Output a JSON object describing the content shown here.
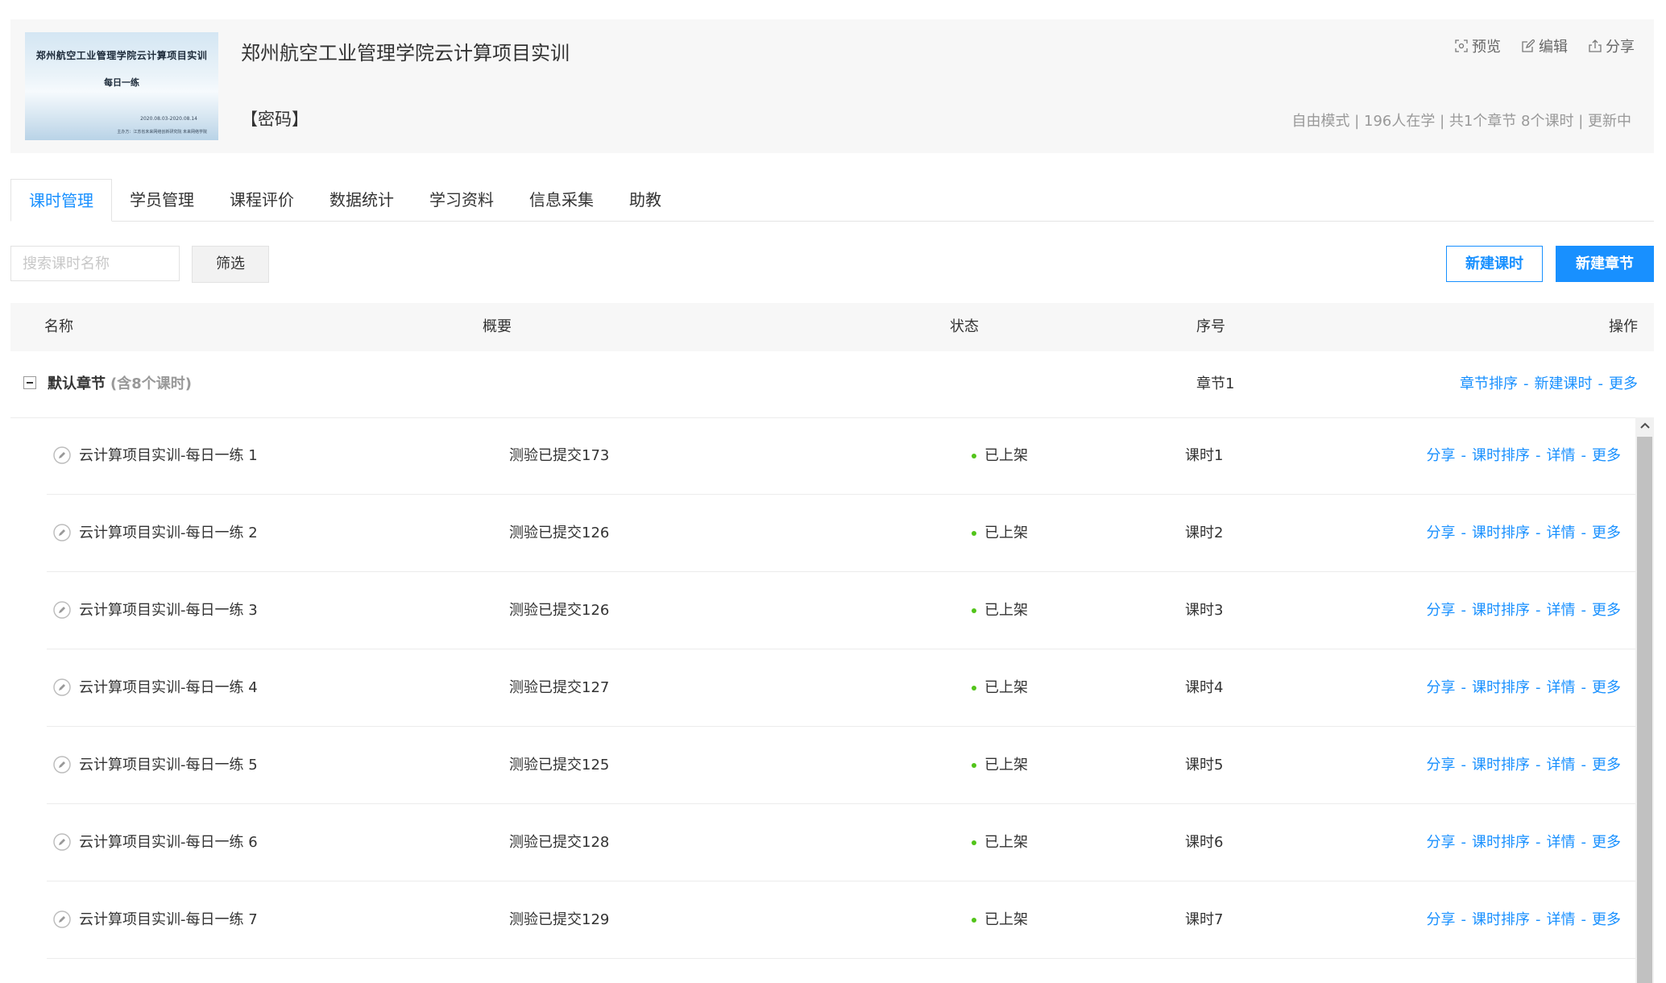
{
  "course": {
    "cover": {
      "title": "郑州航空工业管理学院云计算项目实训",
      "subtitle": "每日一练",
      "date_range": "2020.08.03-2020.08.14",
      "org": "主办方：江苏省未来网络创新研究院 未来网络学院"
    },
    "title": "郑州航空工业管理学院云计算项目实训",
    "password": "【密码】",
    "actions": {
      "preview": "预览",
      "edit": "编辑",
      "share": "分享"
    },
    "meta": "自由模式 | 196人在学 | 共1个章节 8个课时 | 更新中"
  },
  "tabs": [
    {
      "label": "课时管理",
      "active": true
    },
    {
      "label": "学员管理",
      "active": false
    },
    {
      "label": "课程评价",
      "active": false
    },
    {
      "label": "数据统计",
      "active": false
    },
    {
      "label": "学习资料",
      "active": false
    },
    {
      "label": "信息采集",
      "active": false
    },
    {
      "label": "助教",
      "active": false
    }
  ],
  "toolbar": {
    "search_placeholder": "搜索课时名称",
    "filter_label": "筛选",
    "new_lesson_label": "新建课时",
    "new_chapter_label": "新建章节"
  },
  "table": {
    "headers": {
      "name": "名称",
      "summary": "概要",
      "status": "状态",
      "seq": "序号",
      "ops": "操作"
    },
    "chapter": {
      "name": "默认章节",
      "count": "(含8个课时)",
      "seq": "章节1",
      "ops": [
        "章节排序",
        "新建课时",
        "更多"
      ]
    },
    "lesson_ops": [
      "分享",
      "课时排序",
      "详情",
      "更多"
    ],
    "lessons": [
      {
        "name": "云计算项目实训-每日一练 1",
        "summary": "测验已提交173",
        "status": "已上架",
        "seq": "课时1"
      },
      {
        "name": "云计算项目实训-每日一练 2",
        "summary": "测验已提交126",
        "status": "已上架",
        "seq": "课时2"
      },
      {
        "name": "云计算项目实训-每日一练 3",
        "summary": "测验已提交126",
        "status": "已上架",
        "seq": "课时3"
      },
      {
        "name": "云计算项目实训-每日一练 4",
        "summary": "测验已提交127",
        "status": "已上架",
        "seq": "课时4"
      },
      {
        "name": "云计算项目实训-每日一练 5",
        "summary": "测验已提交125",
        "status": "已上架",
        "seq": "课时5"
      },
      {
        "name": "云计算项目实训-每日一练 6",
        "summary": "测验已提交128",
        "status": "已上架",
        "seq": "课时6"
      },
      {
        "name": "云计算项目实训-每日一练 7",
        "summary": "测验已提交129",
        "status": "已上架",
        "seq": "课时7"
      }
    ]
  },
  "colors": {
    "accent": "#1890ff",
    "status_online": "#52c41a",
    "meta_text": "#999999"
  },
  "icons": {
    "preview": "preview-icon",
    "edit": "edit-icon",
    "share": "share-icon",
    "lesson": "pencil-circle-icon",
    "collapse": "collapse-minus-icon",
    "scroll_up": "chevron-up-icon"
  }
}
